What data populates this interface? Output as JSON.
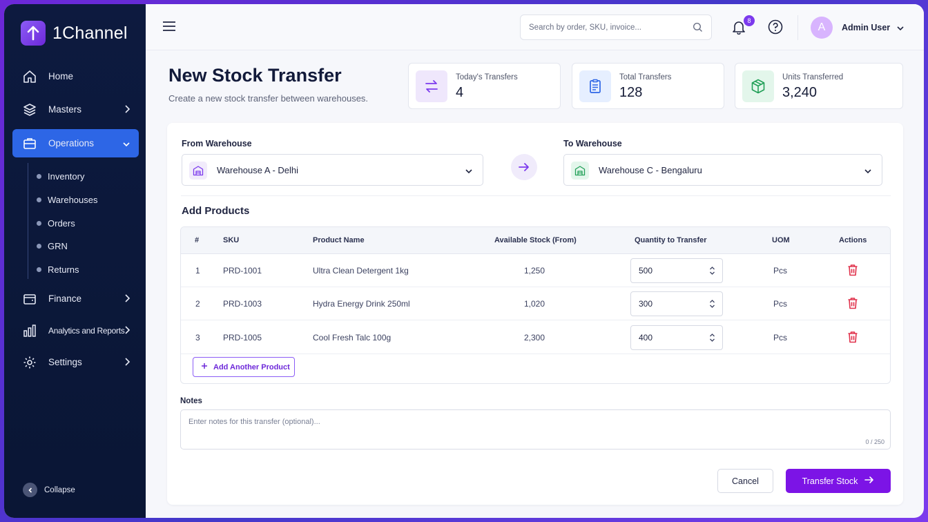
{
  "brand": {
    "name": "1Channel"
  },
  "sidebar": {
    "items": [
      {
        "label": "Home"
      },
      {
        "label": "Masters"
      },
      {
        "label": "Operations"
      },
      {
        "label": "Finance"
      },
      {
        "label": "Analytics and Reports"
      },
      {
        "label": "Settings"
      }
    ],
    "subitems": [
      {
        "label": "Inventory"
      },
      {
        "label": "Warehouses"
      },
      {
        "label": "Orders"
      },
      {
        "label": "GRN"
      },
      {
        "label": "Returns"
      }
    ],
    "collapse_label": "Collapse"
  },
  "topbar": {
    "search_placeholder": "Search by order, SKU, invoice...",
    "notification_count": "8",
    "avatar_initial": "A",
    "user_name": "Admin User"
  },
  "page": {
    "title": "New Stock Transfer",
    "subtitle": "Create a new stock transfer between warehouses."
  },
  "stats": [
    {
      "label": "Today's Transfers",
      "value": "4"
    },
    {
      "label": "Total Transfers",
      "value": "128"
    },
    {
      "label": "Units Transferred",
      "value": "3,240"
    }
  ],
  "form": {
    "from_label": "From Warehouse",
    "from_value": "Warehouse A - Delhi",
    "to_label": "To Warehouse",
    "to_value": "Warehouse C - Bengaluru",
    "section_title": "Add Products",
    "columns": [
      "#",
      "SKU",
      "Product Name",
      "Available Stock (From)",
      "Quantity to Transfer",
      "UOM",
      "Actions"
    ],
    "rows": [
      {
        "num": "1",
        "sku": "PRD-1001",
        "name": "Ultra Clean Detergent 1kg",
        "stock": "1,250",
        "qty": "500",
        "uom": "Pcs"
      },
      {
        "num": "2",
        "sku": "PRD-1003",
        "name": "Hydra Energy Drink 250ml",
        "stock": "1,020",
        "qty": "300",
        "uom": "Pcs"
      },
      {
        "num": "3",
        "sku": "PRD-1005",
        "name": "Cool Fresh Talc 100g",
        "stock": "2,300",
        "qty": "400",
        "uom": "Pcs"
      }
    ],
    "add_product_label": "Add Another Product",
    "notes_label": "Notes",
    "notes_placeholder": "Enter notes for this transfer (optional)...",
    "notes_count": "0 / 250",
    "cancel_label": "Cancel",
    "submit_label": "Transfer Stock"
  },
  "colors": {
    "accent": "#7c14e6",
    "sidebar_bg": "#0d1a3f",
    "active_nav": "#2d66e6",
    "delete": "#e0304a"
  }
}
